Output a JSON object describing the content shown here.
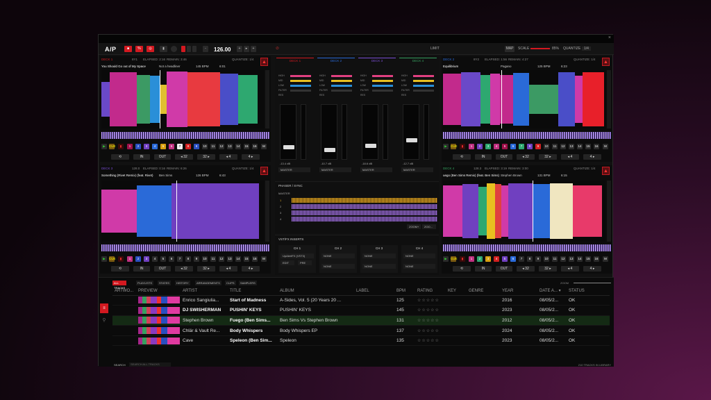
{
  "toolbar": {
    "logo": "A/P",
    "bpm": "126.00",
    "limit": "LIMIT",
    "map": "MAP",
    "scale_label": "SCALE",
    "scale_value": "85%",
    "quantize_label": "QUANTIZE",
    "quantize_value": "1/4"
  },
  "decks": [
    {
      "label": "DECK 1",
      "key": "8Y1",
      "elapsed": "ELAPSED: 2:16",
      "remain": "REMAIN: 3:46",
      "quantize": "QUANTIZE: 1/4",
      "title": "You Should Go out of My Space",
      "artist": "Not a headliner",
      "bpm": "145 BPM",
      "time": "6:01",
      "color": "#d31920"
    },
    {
      "label": "DECK 2",
      "key": "8Y2",
      "elapsed": "ELAPSED: 1:56",
      "remain": "REMAIN: 4:27",
      "quantize": "QUANTIZE: 1/4",
      "title": "Equilibrium",
      "artist": "Pagano",
      "bpm": "125 BPM",
      "time": "6:23",
      "color": "#2a6ad8"
    },
    {
      "label": "DECK 3",
      "key": "128.0",
      "elapsed": "ELAPSED: 0:16",
      "remain": "REMAIN: 6:26",
      "quantize": "QUANTIZE: 1/4",
      "title": "Something (Rivet Remix) (feat. Rivet)",
      "artist": "Ben Sims",
      "bpm": "126 BPM",
      "time": "6:43",
      "color": "#7b4fd6"
    },
    {
      "label": "DECK 4",
      "key": "128.3",
      "elapsed": "ELAPSED: 3:19",
      "remain": "REMAIN: 3:00",
      "quantize": "QUANTIZE: 1/4",
      "title": "uego (Ben Sims Remix) (feat. Ben Sims)",
      "artist": "Stephen Brown",
      "bpm": "131 BPM",
      "time": "6:15",
      "color": "#36a060"
    }
  ],
  "loops": {
    "in": "IN",
    "out": "OUT",
    "l1": "◂ 32",
    "l2": "32 ▸",
    "l3": "◂ 4",
    "l4": "4 ▸"
  },
  "cues": [
    "CUE",
    "1",
    "2",
    "3",
    "4",
    "5",
    "6",
    "7",
    "8",
    "9",
    "10",
    "11",
    "12",
    "13",
    "14",
    "15",
    "16",
    "M"
  ],
  "mixer": {
    "channels": [
      {
        "label": "DECK 1",
        "db": "-13.4 dB",
        "out": "MASTER"
      },
      {
        "label": "DECK 2",
        "db": "-10.7 dB",
        "out": "MASTER"
      },
      {
        "label": "DECK 3",
        "db": "-18.6 dB",
        "out": "MASTER"
      },
      {
        "label": "DECK 4",
        "db": "-12.7 dB",
        "out": "MASTER"
      }
    ],
    "eq": [
      "HIGH",
      "MID",
      "LOW",
      "FILTER",
      "RES"
    ]
  },
  "phase": {
    "title": "PHASER / SYNC",
    "master": "MASTER",
    "lanes": [
      "1",
      "2",
      "3",
      "4"
    ],
    "zoom1": "ZOOM+",
    "zoom2": "ZOO..."
  },
  "vst": {
    "title": "VST/FX INSERTS",
    "chs": [
      "CH 1",
      "CH 2",
      "CH 3",
      "CH 4"
    ],
    "ch1_fx": "UpAlertFX (VST3)",
    "edit": "EDIT",
    "pre": "PRE",
    "none": "NONE"
  },
  "library": {
    "tabs": [
      "ALL TRACKS",
      "PLAYLISTS",
      "STATES",
      "HISTORY",
      "ARRANGEMENTS",
      "CLIPS",
      "SAMPLERS"
    ],
    "zoom": "ZOOM",
    "columns": [
      "ARTWO...",
      "PREVIEW",
      "ARTIST",
      "TITLE",
      "ALBUM",
      "LABEL",
      "BPM",
      "RATING",
      "KEY",
      "GENRE",
      "YEAR",
      "DATE A... ▾",
      "STATUS"
    ],
    "rows": [
      {
        "artist": "Enrico Sangiulia...",
        "title": "Start of Madness",
        "album": "A-Sides, Vol. 5 (20 Years 20 ...",
        "bpm": "125",
        "year": "2016",
        "date": "08/05/2...",
        "status": "OK"
      },
      {
        "artist": "DJ SWISHERMAN",
        "title": "PUSHIN' KEYS",
        "album": "PUSHIN' KEYS",
        "bpm": "145",
        "year": "2023",
        "date": "08/05/2...",
        "status": "OK"
      },
      {
        "artist": "Stephen Brown",
        "title": "Fuego (Ben Sims...",
        "album": "Ben Sims Vs Stephen Brown",
        "bpm": "131",
        "year": "2012",
        "date": "08/05/2...",
        "status": "OK"
      },
      {
        "artist": "Chlär & Vault Re...",
        "title": "Body Whispers",
        "album": "Body Whispers EP",
        "bpm": "137",
        "year": "2024",
        "date": "08/05/2...",
        "status": "OK"
      },
      {
        "artist": "Cave",
        "title": "Speleon (Ben Sim...",
        "album": "Speleon",
        "bpm": "135",
        "year": "2023",
        "date": "08/05/2...",
        "status": "OK"
      }
    ],
    "stars": "☆☆☆☆☆",
    "search_label": "SEARCH",
    "search_placeholder": "SEARCH ALL TRACKS",
    "count": "210 TRACKS IN LIBRARY"
  }
}
